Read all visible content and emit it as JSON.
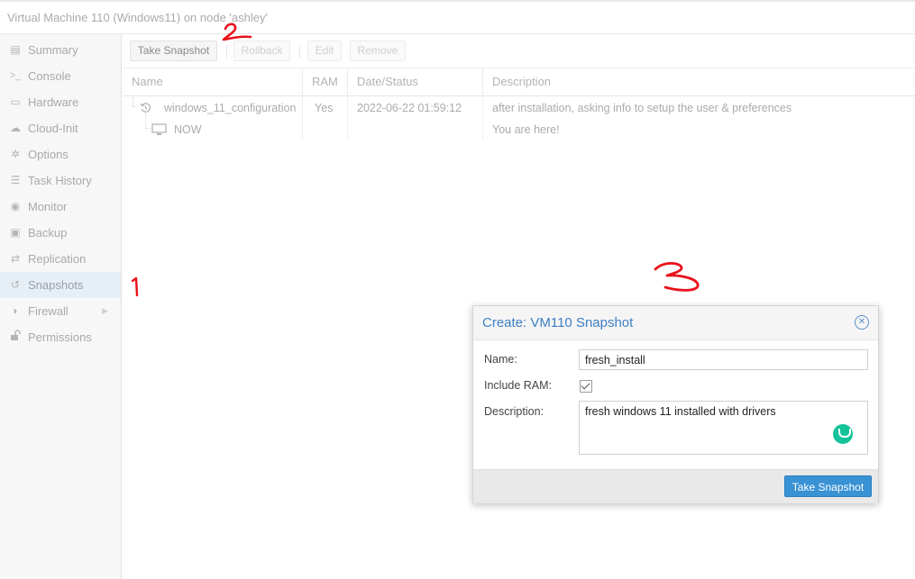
{
  "window": {
    "title": "Virtual Machine 110 (Windows11) on node 'ashley'"
  },
  "sidebar": {
    "items": [
      {
        "label": "Summary",
        "icon": "book-icon",
        "glyph": "▤"
      },
      {
        "label": "Console",
        "icon": "terminal-icon",
        "glyph": ">_"
      },
      {
        "label": "Hardware",
        "icon": "monitor-icon",
        "glyph": "▭"
      },
      {
        "label": "Cloud-Init",
        "icon": "cloud-icon",
        "glyph": "☁"
      },
      {
        "label": "Options",
        "icon": "gear-icon",
        "glyph": "✲"
      },
      {
        "label": "Task History",
        "icon": "list-icon",
        "glyph": "☰"
      },
      {
        "label": "Monitor",
        "icon": "eye-icon",
        "glyph": "◉"
      },
      {
        "label": "Backup",
        "icon": "floppy-icon",
        "glyph": "▣"
      },
      {
        "label": "Replication",
        "icon": "retweet-icon",
        "glyph": "⇄"
      },
      {
        "label": "Snapshots",
        "icon": "history-icon",
        "glyph": "↺",
        "active": true
      },
      {
        "label": "Firewall",
        "icon": "shield-icon",
        "glyph": "◗",
        "arrow": "▶"
      },
      {
        "label": "Permissions",
        "icon": "unlock-icon",
        "glyph": "🔓"
      }
    ]
  },
  "toolbar": {
    "take_snapshot": "Take Snapshot",
    "rollback": "Rollback",
    "edit": "Edit",
    "remove": "Remove"
  },
  "grid": {
    "columns": [
      "Name",
      "RAM",
      "Date/Status",
      "Description"
    ],
    "rows": [
      {
        "name": "windows_11_configuration",
        "ram": "Yes",
        "date": "2022-06-22 01:59:12",
        "description": "after installation, asking info to setup the user & preferences"
      },
      {
        "name": "NOW",
        "ram": "",
        "date": "",
        "description": "You are here!"
      }
    ]
  },
  "annotations": {
    "one": "1",
    "two": "2",
    "three": "3",
    "color": "#e8121b"
  },
  "dialog": {
    "title": "Create: VM110 Snapshot",
    "name_label": "Name:",
    "name_value": "fresh_install",
    "ram_label": "Include RAM:",
    "ram_checked": true,
    "description_label": "Description:",
    "description_value": "fresh windows 11 installed with drivers",
    "submit": "Take Snapshot"
  },
  "colors": {
    "accent": "#3892d4",
    "title_blue": "#3c7fc4",
    "grammarly": "#15c39a"
  }
}
